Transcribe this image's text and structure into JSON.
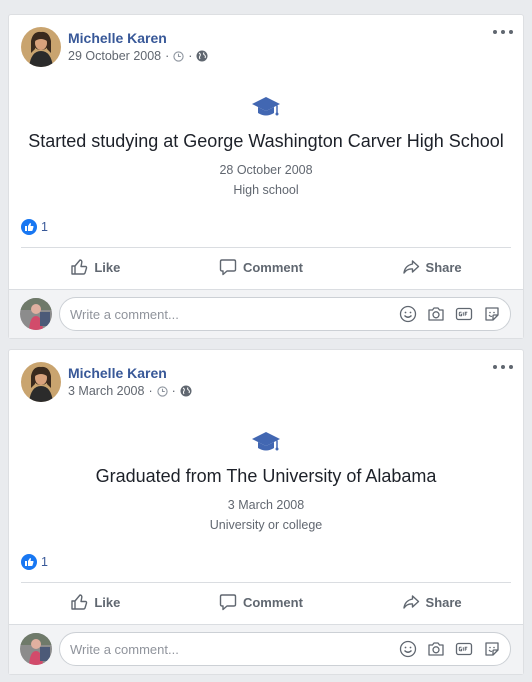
{
  "posts": [
    {
      "author": "Michelle Karen",
      "date": "29 October 2008",
      "separator": "·",
      "event_title": "Started studying at George Washington Carver High School",
      "event_date": "28 October 2008",
      "event_type": "High school",
      "reaction_count": "1",
      "like_label": "Like",
      "comment_label": "Comment",
      "share_label": "Share",
      "comment_placeholder": "Write a comment..."
    },
    {
      "author": "Michelle Karen",
      "date": "3 March 2008",
      "separator": "·",
      "event_title": "Graduated from The University of Alabama",
      "event_date": "3 March 2008",
      "event_type": "University or college",
      "reaction_count": "1",
      "like_label": "Like",
      "comment_label": "Comment",
      "share_label": "Share",
      "comment_placeholder": "Write a comment..."
    }
  ],
  "colors": {
    "accent": "#385898",
    "like_blue": "#1877f2",
    "event_icon": "#4267b2",
    "secondary_text": "#616770",
    "feed_background": "#e9ebee"
  },
  "icons": [
    "clock-icon",
    "globe-icon",
    "more-options-icon",
    "graduation-cap-icon",
    "like-reaction-icon",
    "thumbs-up-icon",
    "comment-icon",
    "share-icon",
    "emoji-icon",
    "camera-icon",
    "gif-icon",
    "sticker-icon"
  ]
}
